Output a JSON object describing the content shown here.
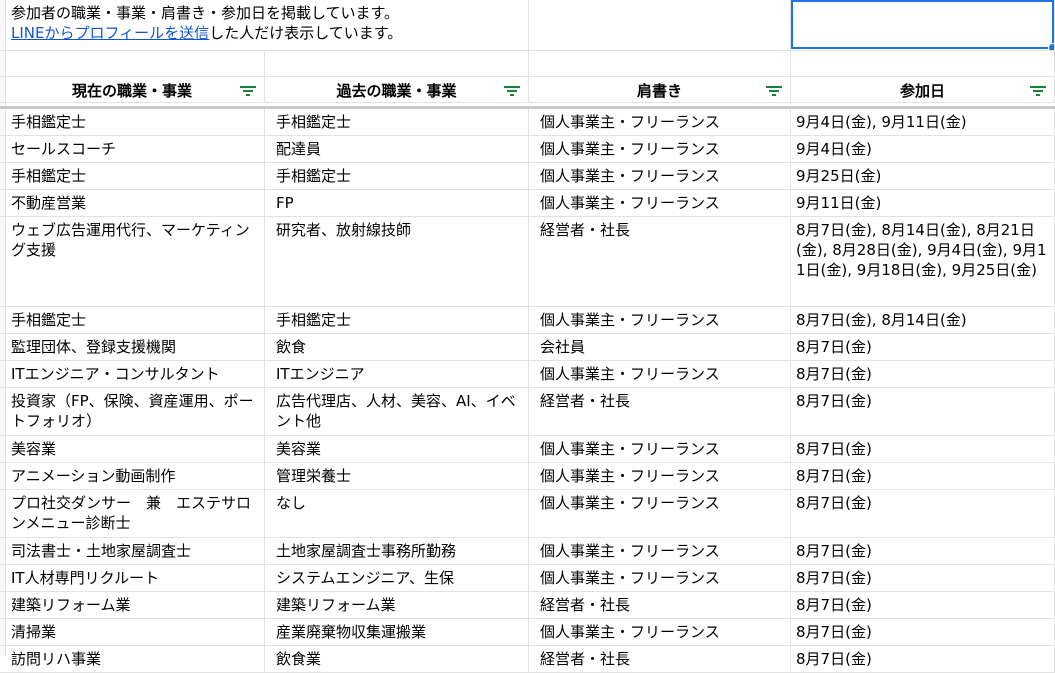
{
  "note": {
    "line1": "参加者の職業・事業・肩書き・参加日を掲載しています。",
    "link": "LINEからプロフィールを送信",
    "line2_rest": "した人だけ表示しています。"
  },
  "headers": [
    "現在の職業・事業",
    "過去の職業・事業",
    "肩書き",
    "参加日"
  ],
  "rows": [
    [
      "手相鑑定士",
      "手相鑑定士",
      "個人事業主・フリーランス",
      "9月4日(金), 9月11日(金)"
    ],
    [
      "セールスコーチ",
      "配達員",
      "個人事業主・フリーランス",
      "9月4日(金)"
    ],
    [
      "手相鑑定士",
      "手相鑑定士",
      "個人事業主・フリーランス",
      "9月25日(金)"
    ],
    [
      "不動産営業",
      "FP",
      "個人事業主・フリーランス",
      "9月11日(金)"
    ],
    [
      "ウェブ広告運用代行、マーケティング支援",
      "研究者、放射線技師",
      "経営者・社長",
      "8月7日(金), 8月14日(金), 8月21日(金), 8月28日(金), 9月4日(金), 9月11日(金), 9月18日(金), 9月25日(金)"
    ],
    [
      "手相鑑定士",
      "手相鑑定士",
      "個人事業主・フリーランス",
      "8月7日(金), 8月14日(金)"
    ],
    [
      "監理団体、登録支援機関",
      "飲食",
      "会社員",
      "8月7日(金)"
    ],
    [
      "ITエンジニア・コンサルタント",
      "ITエンジニア",
      "個人事業主・フリーランス",
      "8月7日(金)"
    ],
    [
      "投資家（FP、保険、資産運用、ポートフォリオ）",
      "広告代理店、人材、美容、AI、イベント他",
      "経営者・社長",
      "8月7日(金)"
    ],
    [
      "美容業",
      "美容業",
      "個人事業主・フリーランス",
      "8月7日(金)"
    ],
    [
      "アニメーション動画制作",
      "管理栄養士",
      "個人事業主・フリーランス",
      "8月7日(金)"
    ],
    [
      "プロ社交ダンサー　兼　エステサロンメニュー診断士",
      "なし",
      "個人事業主・フリーランス",
      "8月7日(金)"
    ],
    [
      "司法書士・土地家屋調査士",
      "土地家屋調査士事務所勤務",
      "個人事業主・フリーランス",
      "8月7日(金)"
    ],
    [
      "IT人材専門リクルート",
      "システムエンジニア、生保",
      "個人事業主・フリーランス",
      "8月7日(金)"
    ],
    [
      "建築リフォーム業",
      "建築リフォーム業",
      "経営者・社長",
      "8月7日(金)"
    ],
    [
      "清掃業",
      "産業廃棄物収集運搬業",
      "個人事業主・フリーランス",
      "8月7日(金)"
    ],
    [
      "訪問リハ事業",
      "飲食業",
      "経営者・社長",
      "8月7日(金)"
    ]
  ]
}
